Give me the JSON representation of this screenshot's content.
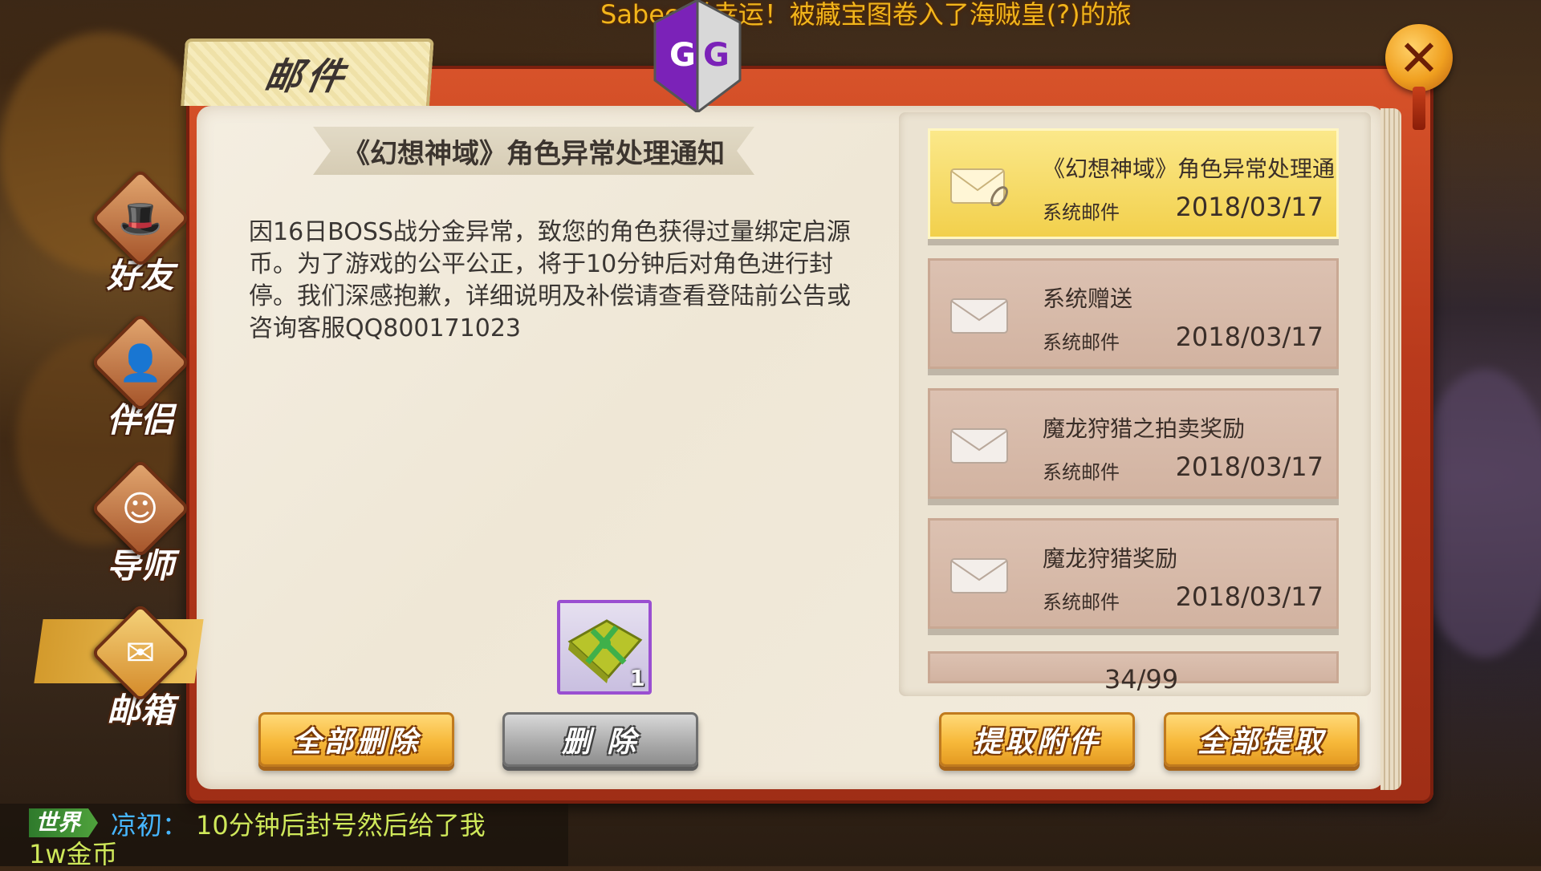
{
  "ticker": "Sabec 常幸运！被藏宝图卷入了海贼皇(?)的旅",
  "window": {
    "title": "邮件",
    "close_icon": "close-icon"
  },
  "overlay": {
    "badge_text": "GG"
  },
  "sidebar": {
    "items": [
      {
        "label": "好友",
        "icon": "hat-icon"
      },
      {
        "label": "伴侣",
        "icon": "person-icon"
      },
      {
        "label": "导师",
        "icon": "mentor-icon"
      },
      {
        "label": "邮箱",
        "icon": "envelope-icon",
        "active": true
      }
    ]
  },
  "mail": {
    "title": "《幻想神域》角色异常处理通知",
    "body": "因16日BOSS战分金异常，致您的角色获得过量绑定启源币。为了游戏的公平公正，将于10分钟后对角色进行封停。我们深感抱歉，详细说明及补偿请查看登陆前公告或咨询客服QQ800171023",
    "attachment": {
      "icon": "gift-package-icon",
      "count": "1",
      "frame_color": "#9a4fd1"
    }
  },
  "buttons": {
    "delete_all": "全部删除",
    "delete": "删 除",
    "take_attachment": "提取附件",
    "take_all": "全部提取"
  },
  "mail_list": {
    "items": [
      {
        "title": "《幻想神域》角色异常处理通",
        "type": "系统邮件",
        "date": "2018/03/17",
        "selected": true,
        "has_attachment": true
      },
      {
        "title": "系统赠送",
        "type": "系统邮件",
        "date": "2018/03/17"
      },
      {
        "title": "魔龙狩猎之拍卖奖励",
        "type": "系统邮件",
        "date": "2018/03/17"
      },
      {
        "title": "魔龙狩猎奖励",
        "type": "系统邮件",
        "date": "2018/03/17"
      }
    ],
    "counter": "34/99"
  },
  "chat": {
    "channel": "世界",
    "sender": "凉初",
    "separator": "：",
    "message_line1": "10分钟后封号然后给了我",
    "message_line2": "1w金币"
  },
  "colors": {
    "frame_red": "#b93a1c",
    "button_gold": "#f7b93a",
    "selected_mail": "#f2d04c",
    "ticker_gold": "#f2b51b",
    "chat_name": "#47b6ff",
    "chat_text": "#cfe85a"
  }
}
